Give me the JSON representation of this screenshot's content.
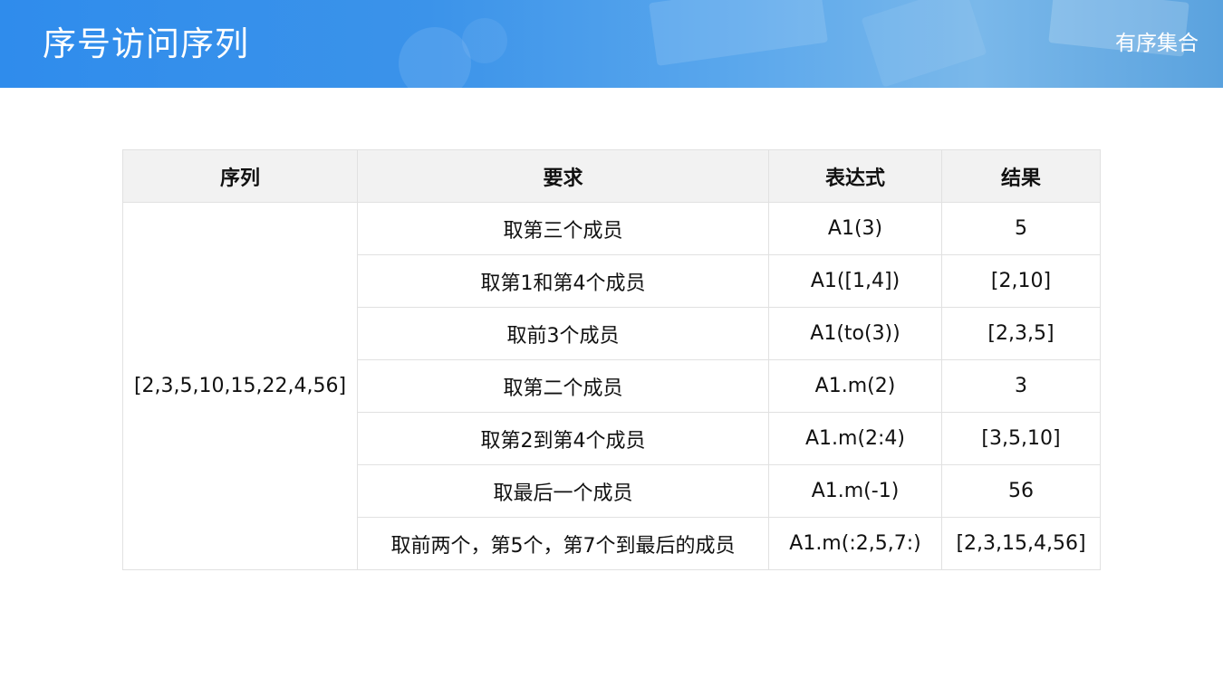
{
  "header": {
    "title": "序号访问序列",
    "section": "有序集合",
    "accent_color": "#2f8cec"
  },
  "table": {
    "columns": [
      "序列",
      "要求",
      "表达式",
      "结果"
    ],
    "sequence": "[2,3,5,10,15,22,4,56]",
    "rows": [
      {
        "requirement": "取第三个成员",
        "expression": "A1(3)",
        "result": "5"
      },
      {
        "requirement": "取第1和第4个成员",
        "expression": "A1([1,4])",
        "result": "[2,10]"
      },
      {
        "requirement": "取前3个成员",
        "expression": "A1(to(3))",
        "result": "[2,3,5]"
      },
      {
        "requirement": "取第二个成员",
        "expression": "A1.m(2)",
        "result": "3"
      },
      {
        "requirement": "取第2到第4个成员",
        "expression": "A1.m(2:4)",
        "result": "[3,5,10]"
      },
      {
        "requirement": "取最后一个成员",
        "expression": "A1.m(-1)",
        "result": "56"
      },
      {
        "requirement": "取前两个，第5个，第7个到最后的成员",
        "expression": "A1.m(:2,5,7:)",
        "result": "[2,3,15,4,56]"
      }
    ]
  }
}
